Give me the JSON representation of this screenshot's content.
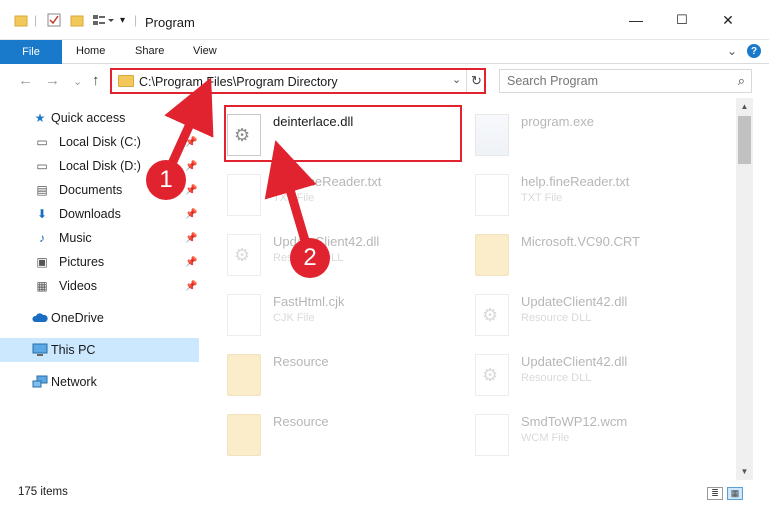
{
  "window": {
    "title": "Program",
    "minimize_glyph": "—",
    "maximize_glyph": "☐",
    "close_glyph": "✕"
  },
  "ribbon": {
    "tabs": [
      "File",
      "Home",
      "Share",
      "View"
    ],
    "help_glyph": "?",
    "expand_glyph": "⌄"
  },
  "address": {
    "path": "C:\\Program Files\\Program Directory",
    "back_glyph": "←",
    "forward_glyph": "→",
    "recent_glyph": "⌄",
    "up_glyph": "↑",
    "dropdown_glyph": "⌄",
    "refresh_glyph": "↻"
  },
  "search": {
    "placeholder": "Search Program",
    "icon_glyph": "⌕"
  },
  "navpane": {
    "quick_access": "Quick access",
    "quick_items": [
      {
        "label": "Local Disk (C:)",
        "icon": "drive-icon",
        "glyph": "▭"
      },
      {
        "label": "Local Disk (D:)",
        "icon": "drive-icon",
        "glyph": "▭"
      },
      {
        "label": "Documents",
        "icon": "documents-icon",
        "glyph": "▤"
      },
      {
        "label": "Downloads",
        "icon": "downloads-icon",
        "glyph": "⬇"
      },
      {
        "label": "Music",
        "icon": "music-icon",
        "glyph": "♪"
      },
      {
        "label": "Pictures",
        "icon": "pictures-icon",
        "glyph": "▣"
      },
      {
        "label": "Videos",
        "icon": "videos-icon",
        "glyph": "▦"
      }
    ],
    "onedrive": "OneDrive",
    "thispc": "This PC",
    "network": "Network",
    "pin_glyph": "📌"
  },
  "files": [
    {
      "name": "deinterlace.dll",
      "type": "",
      "icon": "dll-icon",
      "faded": false
    },
    {
      "name": "program.exe",
      "type": "",
      "icon": "exe-icon",
      "faded": true
    },
    {
      "name": "help.fineReader.txt",
      "type": "TXT File",
      "icon": "text-file-icon",
      "faded": true
    },
    {
      "name": "help.fineReader.txt",
      "type": "TXT File",
      "icon": "text-file-icon",
      "faded": true
    },
    {
      "name": "UpdateClient42.dll",
      "type": "Resource DLL",
      "icon": "dll-icon",
      "faded": true
    },
    {
      "name": "Microsoft.VC90.CRT",
      "type": "",
      "icon": "folder-icon",
      "faded": true
    },
    {
      "name": "FastHtml.cjk",
      "type": "CJK File",
      "icon": "file-icon",
      "faded": true
    },
    {
      "name": "UpdateClient42.dll",
      "type": "Resource DLL",
      "icon": "dll-icon",
      "faded": true
    },
    {
      "name": "Resource",
      "type": "",
      "icon": "folder-icon",
      "faded": true
    },
    {
      "name": "UpdateClient42.dll",
      "type": "Resource DLL",
      "icon": "dll-icon",
      "faded": true
    },
    {
      "name": "Resource",
      "type": "",
      "icon": "folder-icon",
      "faded": true
    },
    {
      "name": "SmdToWP12.wcm",
      "type": "WCM File",
      "icon": "file-icon",
      "faded": true
    }
  ],
  "status": {
    "count": "175 items"
  },
  "annotations": {
    "badge1": "1",
    "badge2": "2",
    "color": "#e0232f"
  }
}
